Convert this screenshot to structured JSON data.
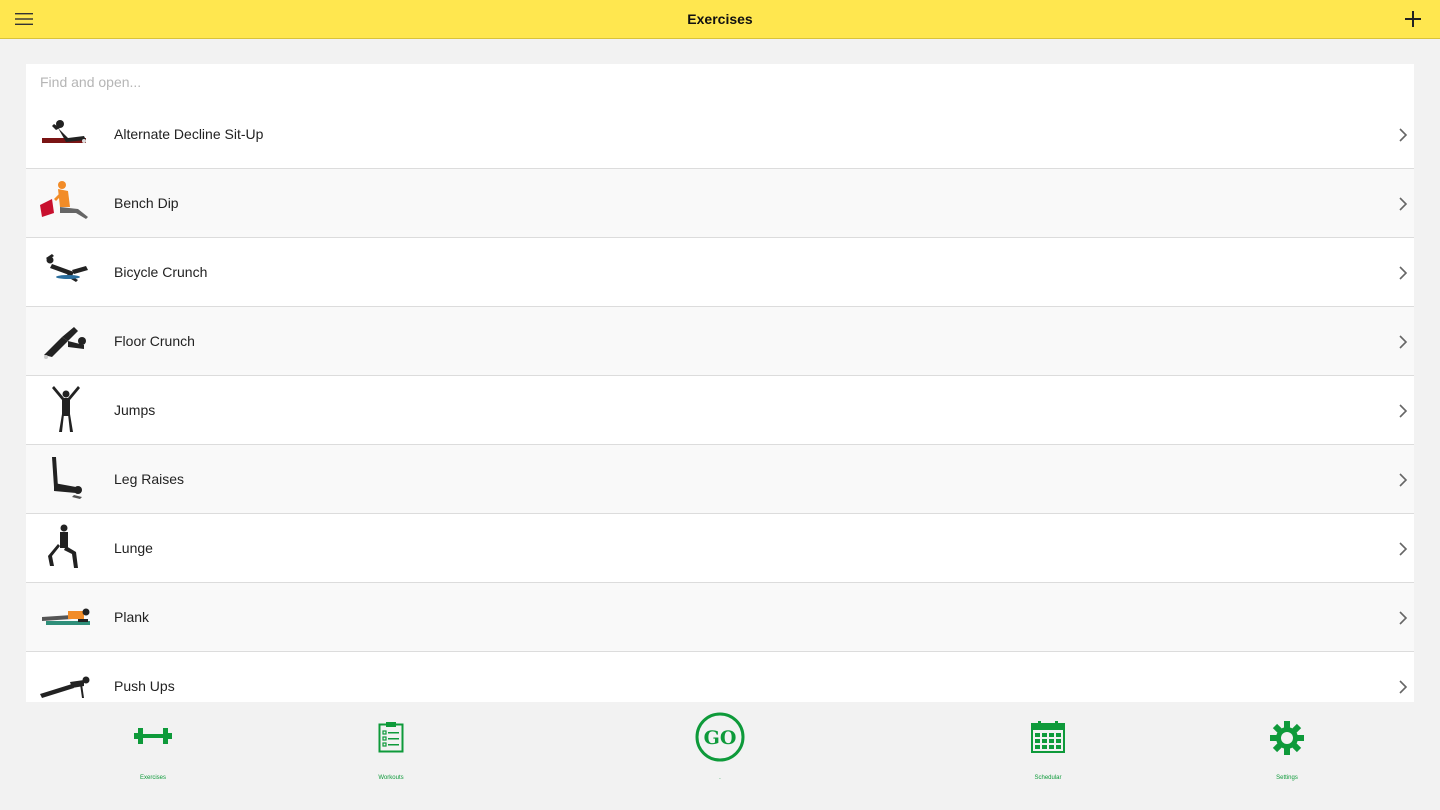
{
  "header": {
    "title": "Exercises",
    "menu_icon": "hamburger-icon",
    "add_icon": "plus-icon"
  },
  "search": {
    "placeholder": "Find and open..."
  },
  "exercises": [
    {
      "label": "Alternate Decline Sit-Up"
    },
    {
      "label": "Bench Dip"
    },
    {
      "label": "Bicycle Crunch"
    },
    {
      "label": "Floor Crunch"
    },
    {
      "label": "Jumps"
    },
    {
      "label": "Leg Raises"
    },
    {
      "label": "Lunge"
    },
    {
      "label": "Plank"
    },
    {
      "label": "Push Ups"
    }
  ],
  "tabs": [
    {
      "label": "Exercises",
      "icon": "dumbbell-icon"
    },
    {
      "label": "Workouts",
      "icon": "clipboard-list-icon"
    },
    {
      "label": ".",
      "icon": "go-button-icon",
      "icon_text": "GO"
    },
    {
      "label": "Schedular",
      "icon": "calendar-icon"
    },
    {
      "label": "Settings",
      "icon": "gear-icon"
    }
  ],
  "colors": {
    "header": "#ffe74f",
    "accent_green": "#0e9a3a",
    "background": "#f2f2f2"
  }
}
